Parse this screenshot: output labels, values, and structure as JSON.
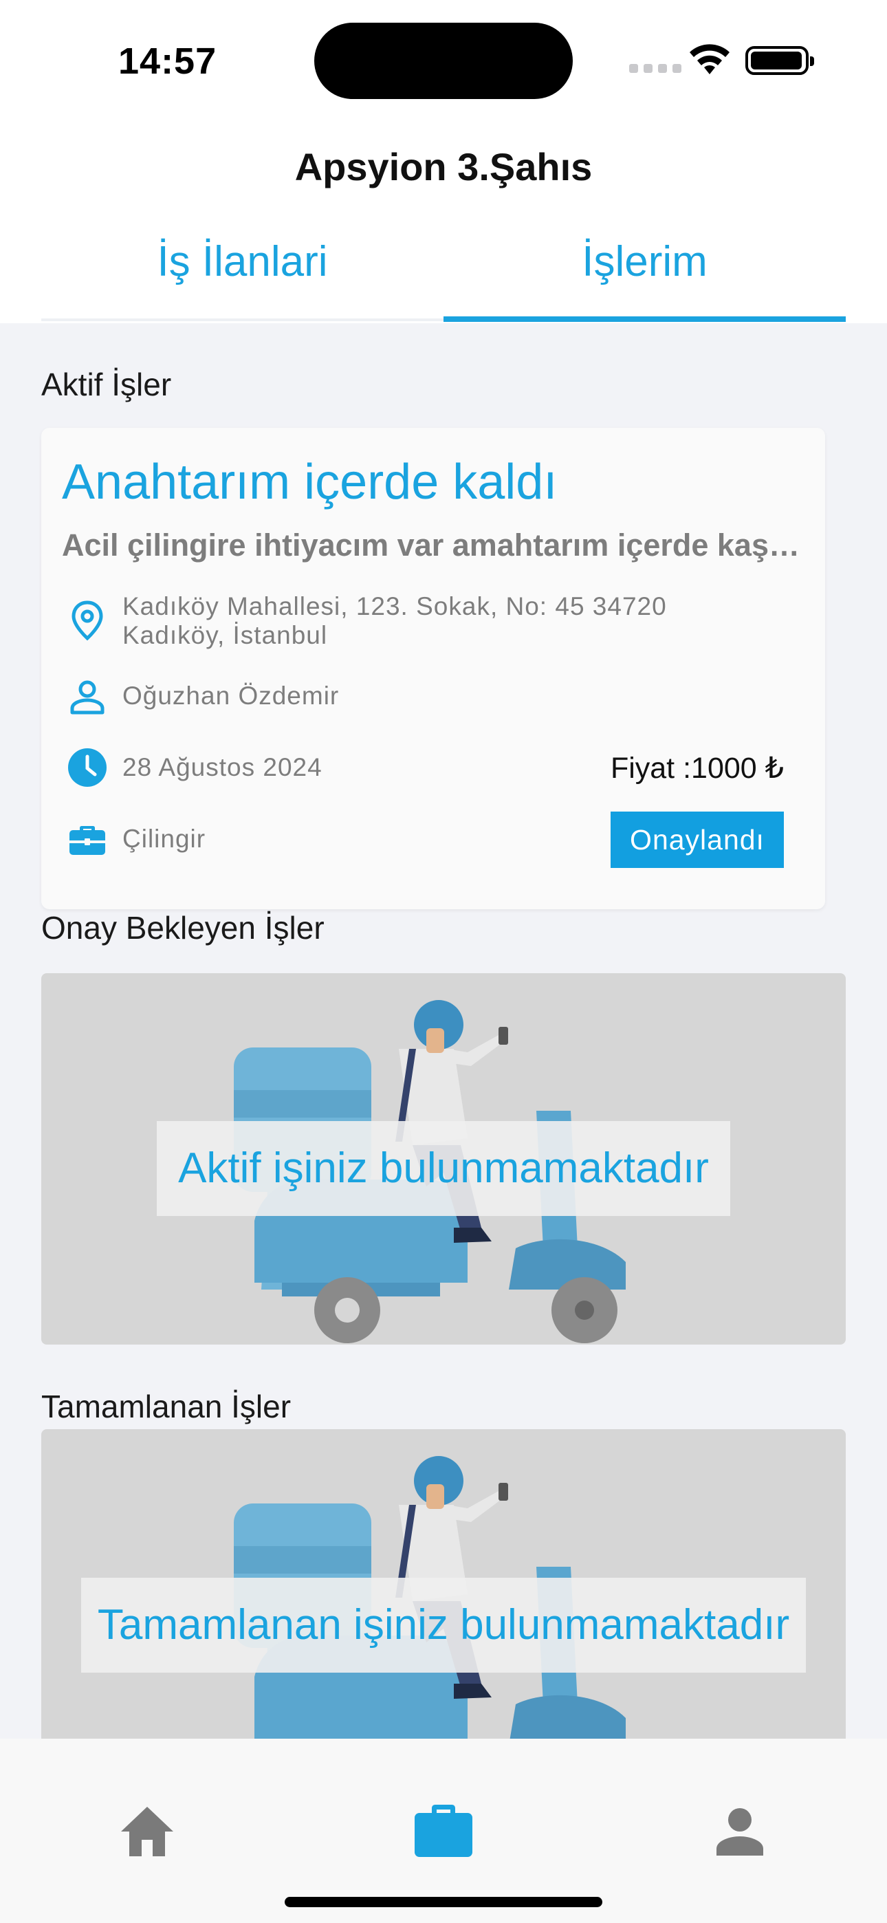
{
  "status_bar": {
    "time": "14:57"
  },
  "header": {
    "title": "Apsyion 3.Şahıs",
    "tabs": [
      {
        "label": "İş İlanlari",
        "active": false
      },
      {
        "label": "İşlerim",
        "active": true
      }
    ]
  },
  "sections": {
    "active": "Aktif İşler",
    "pending": "Onay Bekleyen İşler",
    "completed": "Tamamlanan İşler"
  },
  "job": {
    "title": "Anahtarım içerde kaldı",
    "description": "Acil çilingire ihtiyacım var amahtarım içerde kaşık kaldı lütfen yardım edin",
    "address_line1": "Kadıköy Mahallesi, 123. Sokak, No: 45 34720",
    "address_line2": "Kadıköy, İstanbul",
    "person": "Oğuzhan Özdemir",
    "date": "28 Ağustos 2024",
    "category": "Çilingir",
    "price": "Fiyat :1000 ₺",
    "status": "Onaylandı"
  },
  "empty_states": {
    "pending": "Aktif işiniz bulunmamaktadır",
    "completed": "Tamamlanan işiniz bulunmamaktadır"
  },
  "bottom_nav": [
    {
      "icon": "home-icon",
      "active": false
    },
    {
      "icon": "briefcase-icon",
      "active": true
    },
    {
      "icon": "person-icon",
      "active": false
    }
  ],
  "colors": {
    "accent": "#1aa3df",
    "button": "#129fe0",
    "nav_inactive": "#7a7a7a",
    "background": "#f2f3f7"
  }
}
